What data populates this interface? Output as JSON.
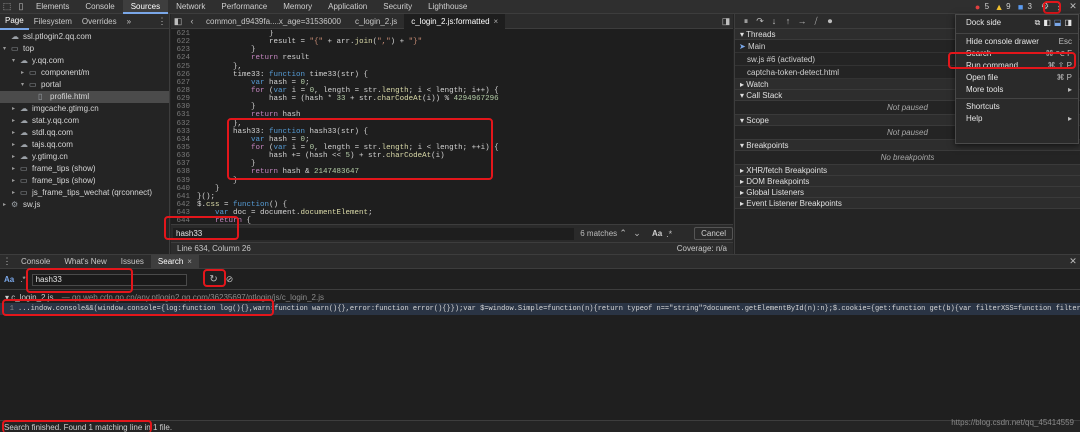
{
  "topbar": {
    "tabs": [
      "Elements",
      "Console",
      "Sources",
      "Network",
      "Performance",
      "Memory",
      "Application",
      "Security",
      "Lighthouse"
    ],
    "active_tab": "Sources",
    "errors": "5",
    "warnings": "9",
    "info": "3"
  },
  "navigator": {
    "tabs": [
      "Page",
      "Filesystem",
      "Overrides"
    ],
    "more": "»",
    "tree": [
      {
        "label": "ssl.ptlogin2.qq.com",
        "indent": 0,
        "type": "cloud",
        "twisty": ""
      },
      {
        "label": "top",
        "indent": 0,
        "type": "folder",
        "twisty": "▾"
      },
      {
        "label": "y.qq.com",
        "indent": 1,
        "type": "cloud",
        "twisty": "▾"
      },
      {
        "label": "component/m",
        "indent": 2,
        "type": "folder",
        "twisty": "▸"
      },
      {
        "label": "portal",
        "indent": 2,
        "type": "folder",
        "twisty": "▾"
      },
      {
        "label": "profile.html",
        "indent": 3,
        "type": "file",
        "twisty": "",
        "selected": true
      },
      {
        "label": "imgcache.gtimg.cn",
        "indent": 1,
        "type": "cloud",
        "twisty": "▸"
      },
      {
        "label": "stat.y.qq.com",
        "indent": 1,
        "type": "cloud",
        "twisty": "▸"
      },
      {
        "label": "stdl.qq.com",
        "indent": 1,
        "type": "cloud",
        "twisty": "▸"
      },
      {
        "label": "tajs.qq.com",
        "indent": 1,
        "type": "cloud",
        "twisty": "▸"
      },
      {
        "label": "y.gtimg.cn",
        "indent": 1,
        "type": "cloud",
        "twisty": "▸"
      },
      {
        "label": "frame_tips (show)",
        "indent": 1,
        "type": "frame",
        "twisty": "▸"
      },
      {
        "label": "frame_tips (show)",
        "indent": 1,
        "type": "frame",
        "twisty": "▸"
      },
      {
        "label": "js_frame_tips_wechat (qrconnect)",
        "indent": 1,
        "type": "frame",
        "twisty": "▸"
      },
      {
        "label": "sw.js",
        "indent": 0,
        "type": "gear",
        "twisty": "▸"
      }
    ]
  },
  "editor": {
    "tabs": [
      "common_d9439fa....x_age=31536000",
      "c_login_2.js",
      "c_login_2.js:formatted"
    ],
    "active_tab": "c_login_2.js:formatted",
    "lines": [
      {
        "n": "621",
        "text": "                }"
      },
      {
        "n": "622",
        "text": "                result = \"{\" + arr.join(\",\") + \"}\""
      },
      {
        "n": "623",
        "text": "            }"
      },
      {
        "n": "624",
        "text": "            return result"
      },
      {
        "n": "625",
        "text": "        },"
      },
      {
        "n": "626",
        "text": "        time33: function time33(str) {"
      },
      {
        "n": "627",
        "text": "            var hash = 0;"
      },
      {
        "n": "628",
        "text": "            for (var i = 0, length = str.length; i < length; i++) {"
      },
      {
        "n": "629",
        "text": "                hash = (hash * 33 + str.charCodeAt(i)) % 4294967296"
      },
      {
        "n": "630",
        "text": "            }"
      },
      {
        "n": "631",
        "text": "            return hash"
      },
      {
        "n": "632",
        "text": "        },"
      },
      {
        "n": "633",
        "text": "        hash33: function hash33(str) {"
      },
      {
        "n": "634",
        "text": "            var hash = 0;"
      },
      {
        "n": "635",
        "text": "            for (var i = 0, length = str.length; i < length; ++i) {"
      },
      {
        "n": "636",
        "text": "                hash += (hash << 5) + str.charCodeAt(i)"
      },
      {
        "n": "637",
        "text": "            }"
      },
      {
        "n": "638",
        "text": "            return hash & 2147483647"
      },
      {
        "n": "639",
        "text": "        }"
      },
      {
        "n": "640",
        "text": "    }"
      },
      {
        "n": "641",
        "text": "}();"
      },
      {
        "n": "642",
        "text": "$.css = function() {"
      },
      {
        "n": "643",
        "text": "    var doc = document.documentElement;"
      },
      {
        "n": "644",
        "text": "    return {"
      },
      {
        "n": "645",
        "text": ""
      }
    ],
    "find_value": "hash33",
    "find_count": "6 matches",
    "find_case": "Aa",
    "find_cancel": "Cancel",
    "status_left": "Line 634, Column 26",
    "status_right": "Coverage: n/a"
  },
  "debugger": {
    "threads_title": "Threads",
    "threads": [
      {
        "label": "Main",
        "current": true
      },
      {
        "label": "sw.js #6 (activated)",
        "current": false
      },
      {
        "label": "captcha-token-detect.html",
        "current": false
      }
    ],
    "watch": "Watch",
    "call_stack": "Call Stack",
    "not_paused": "Not paused",
    "scope": "Scope",
    "breakpoints": "Breakpoints",
    "no_breakpoints": "No breakpoints",
    "xhr": "XHR/fetch Breakpoints",
    "dom": "DOM Breakpoints",
    "global": "Global Listeners",
    "event": "Event Listener Breakpoints"
  },
  "menu": {
    "dock_side": "Dock side",
    "items": [
      {
        "label": "Hide console drawer",
        "shortcut": "Esc"
      },
      {
        "label": "Search",
        "shortcut": "⌘ ⌥ F"
      },
      {
        "label": "Run command",
        "shortcut": "⌘ ⇧ P"
      },
      {
        "label": "Open file",
        "shortcut": "⌘ P"
      },
      {
        "label": "More tools",
        "shortcut": "▸"
      }
    ],
    "items2": [
      {
        "label": "Shortcuts",
        "shortcut": ""
      },
      {
        "label": "Help",
        "shortcut": "▸"
      }
    ]
  },
  "drawer": {
    "tabs": [
      "Console",
      "What's New",
      "Issues",
      "Search"
    ],
    "active_tab": "Search",
    "case_toggle": "Aa",
    "regex_toggle": ".*",
    "search_value": "hash33",
    "result_file": "c_login_2.js",
    "result_url": "— qq.web.cdn.go.cn/any.ptlogin2.qq.com/36235697/ptlogin/js/c_login_2.js",
    "result_line_no": "1",
    "result_line_text": "...indow.console&&(window.console={log:function log(){},warn:function warn(){},error:function error(){}});var $=window.Simple=function(n){return typeof n==\"string\"?document.getElementById(n):n};$.cookie={get:function get(b){var filterXSS=function filterXSS(e){if(!e)return e;for(;e!=unescape(e);)(e=unescape(e))for(var r=[\"<\",\">\",\"'\",\"\\\"\",\"...",
    "status": "Search finished.  Found 1 matching line in 1 file.",
    "watermark": "https://blog.csdn.net/qq_45414559"
  }
}
